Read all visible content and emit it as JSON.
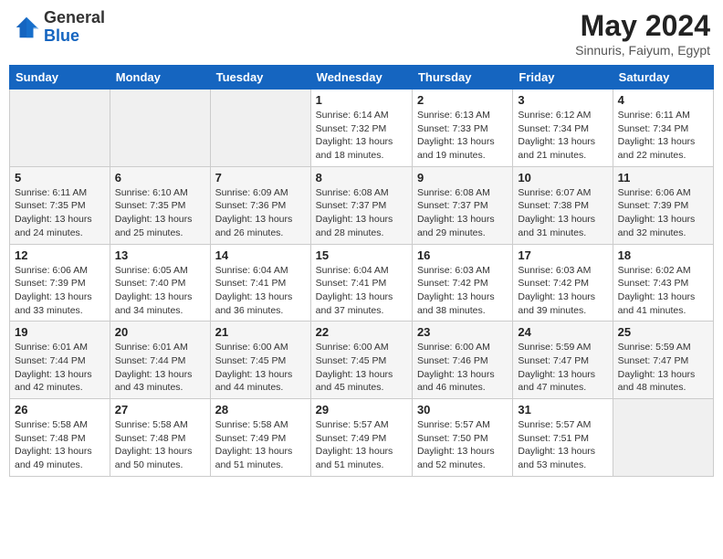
{
  "header": {
    "logo_general": "General",
    "logo_blue": "Blue",
    "main_title": "May 2024",
    "subtitle": "Sinnuris, Faiyum, Egypt"
  },
  "weekdays": [
    "Sunday",
    "Monday",
    "Tuesday",
    "Wednesday",
    "Thursday",
    "Friday",
    "Saturday"
  ],
  "weeks": [
    [
      {
        "day": "",
        "sunrise": "",
        "sunset": "",
        "daylight": ""
      },
      {
        "day": "",
        "sunrise": "",
        "sunset": "",
        "daylight": ""
      },
      {
        "day": "",
        "sunrise": "",
        "sunset": "",
        "daylight": ""
      },
      {
        "day": "1",
        "sunrise": "Sunrise: 6:14 AM",
        "sunset": "Sunset: 7:32 PM",
        "daylight": "Daylight: 13 hours and 18 minutes."
      },
      {
        "day": "2",
        "sunrise": "Sunrise: 6:13 AM",
        "sunset": "Sunset: 7:33 PM",
        "daylight": "Daylight: 13 hours and 19 minutes."
      },
      {
        "day": "3",
        "sunrise": "Sunrise: 6:12 AM",
        "sunset": "Sunset: 7:34 PM",
        "daylight": "Daylight: 13 hours and 21 minutes."
      },
      {
        "day": "4",
        "sunrise": "Sunrise: 6:11 AM",
        "sunset": "Sunset: 7:34 PM",
        "daylight": "Daylight: 13 hours and 22 minutes."
      }
    ],
    [
      {
        "day": "5",
        "sunrise": "Sunrise: 6:11 AM",
        "sunset": "Sunset: 7:35 PM",
        "daylight": "Daylight: 13 hours and 24 minutes."
      },
      {
        "day": "6",
        "sunrise": "Sunrise: 6:10 AM",
        "sunset": "Sunset: 7:35 PM",
        "daylight": "Daylight: 13 hours and 25 minutes."
      },
      {
        "day": "7",
        "sunrise": "Sunrise: 6:09 AM",
        "sunset": "Sunset: 7:36 PM",
        "daylight": "Daylight: 13 hours and 26 minutes."
      },
      {
        "day": "8",
        "sunrise": "Sunrise: 6:08 AM",
        "sunset": "Sunset: 7:37 PM",
        "daylight": "Daylight: 13 hours and 28 minutes."
      },
      {
        "day": "9",
        "sunrise": "Sunrise: 6:08 AM",
        "sunset": "Sunset: 7:37 PM",
        "daylight": "Daylight: 13 hours and 29 minutes."
      },
      {
        "day": "10",
        "sunrise": "Sunrise: 6:07 AM",
        "sunset": "Sunset: 7:38 PM",
        "daylight": "Daylight: 13 hours and 31 minutes."
      },
      {
        "day": "11",
        "sunrise": "Sunrise: 6:06 AM",
        "sunset": "Sunset: 7:39 PM",
        "daylight": "Daylight: 13 hours and 32 minutes."
      }
    ],
    [
      {
        "day": "12",
        "sunrise": "Sunrise: 6:06 AM",
        "sunset": "Sunset: 7:39 PM",
        "daylight": "Daylight: 13 hours and 33 minutes."
      },
      {
        "day": "13",
        "sunrise": "Sunrise: 6:05 AM",
        "sunset": "Sunset: 7:40 PM",
        "daylight": "Daylight: 13 hours and 34 minutes."
      },
      {
        "day": "14",
        "sunrise": "Sunrise: 6:04 AM",
        "sunset": "Sunset: 7:41 PM",
        "daylight": "Daylight: 13 hours and 36 minutes."
      },
      {
        "day": "15",
        "sunrise": "Sunrise: 6:04 AM",
        "sunset": "Sunset: 7:41 PM",
        "daylight": "Daylight: 13 hours and 37 minutes."
      },
      {
        "day": "16",
        "sunrise": "Sunrise: 6:03 AM",
        "sunset": "Sunset: 7:42 PM",
        "daylight": "Daylight: 13 hours and 38 minutes."
      },
      {
        "day": "17",
        "sunrise": "Sunrise: 6:03 AM",
        "sunset": "Sunset: 7:42 PM",
        "daylight": "Daylight: 13 hours and 39 minutes."
      },
      {
        "day": "18",
        "sunrise": "Sunrise: 6:02 AM",
        "sunset": "Sunset: 7:43 PM",
        "daylight": "Daylight: 13 hours and 41 minutes."
      }
    ],
    [
      {
        "day": "19",
        "sunrise": "Sunrise: 6:01 AM",
        "sunset": "Sunset: 7:44 PM",
        "daylight": "Daylight: 13 hours and 42 minutes."
      },
      {
        "day": "20",
        "sunrise": "Sunrise: 6:01 AM",
        "sunset": "Sunset: 7:44 PM",
        "daylight": "Daylight: 13 hours and 43 minutes."
      },
      {
        "day": "21",
        "sunrise": "Sunrise: 6:00 AM",
        "sunset": "Sunset: 7:45 PM",
        "daylight": "Daylight: 13 hours and 44 minutes."
      },
      {
        "day": "22",
        "sunrise": "Sunrise: 6:00 AM",
        "sunset": "Sunset: 7:45 PM",
        "daylight": "Daylight: 13 hours and 45 minutes."
      },
      {
        "day": "23",
        "sunrise": "Sunrise: 6:00 AM",
        "sunset": "Sunset: 7:46 PM",
        "daylight": "Daylight: 13 hours and 46 minutes."
      },
      {
        "day": "24",
        "sunrise": "Sunrise: 5:59 AM",
        "sunset": "Sunset: 7:47 PM",
        "daylight": "Daylight: 13 hours and 47 minutes."
      },
      {
        "day": "25",
        "sunrise": "Sunrise: 5:59 AM",
        "sunset": "Sunset: 7:47 PM",
        "daylight": "Daylight: 13 hours and 48 minutes."
      }
    ],
    [
      {
        "day": "26",
        "sunrise": "Sunrise: 5:58 AM",
        "sunset": "Sunset: 7:48 PM",
        "daylight": "Daylight: 13 hours and 49 minutes."
      },
      {
        "day": "27",
        "sunrise": "Sunrise: 5:58 AM",
        "sunset": "Sunset: 7:48 PM",
        "daylight": "Daylight: 13 hours and 50 minutes."
      },
      {
        "day": "28",
        "sunrise": "Sunrise: 5:58 AM",
        "sunset": "Sunset: 7:49 PM",
        "daylight": "Daylight: 13 hours and 51 minutes."
      },
      {
        "day": "29",
        "sunrise": "Sunrise: 5:57 AM",
        "sunset": "Sunset: 7:49 PM",
        "daylight": "Daylight: 13 hours and 51 minutes."
      },
      {
        "day": "30",
        "sunrise": "Sunrise: 5:57 AM",
        "sunset": "Sunset: 7:50 PM",
        "daylight": "Daylight: 13 hours and 52 minutes."
      },
      {
        "day": "31",
        "sunrise": "Sunrise: 5:57 AM",
        "sunset": "Sunset: 7:51 PM",
        "daylight": "Daylight: 13 hours and 53 minutes."
      },
      {
        "day": "",
        "sunrise": "",
        "sunset": "",
        "daylight": ""
      }
    ]
  ]
}
